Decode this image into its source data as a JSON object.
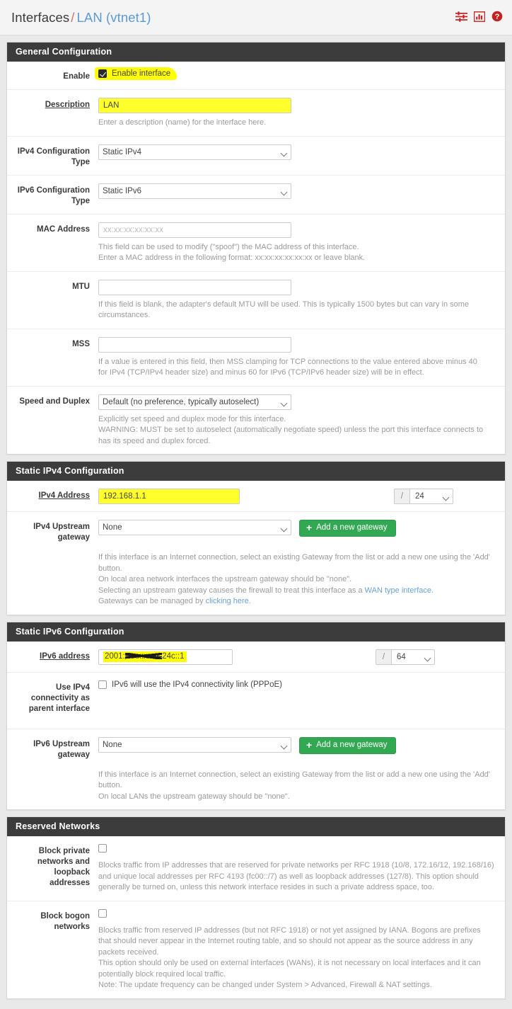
{
  "header": {
    "breadcrumb_root": "Interfaces",
    "breadcrumb_separator": "/",
    "breadcrumb_current": "LAN (vtnet1)",
    "icons": [
      "sliders-icon",
      "chart-bar-icon",
      "help-circle-icon"
    ],
    "accent_red": "#c32222",
    "link_blue": "#5b9bd5"
  },
  "sections": {
    "general": {
      "title": "General Configuration",
      "enable": {
        "label": "Enable",
        "checkbox_label": "Enable interface",
        "checked": true,
        "highlighted": true
      },
      "description": {
        "label": "Description",
        "value": "LAN",
        "help": "Enter a description (name) for the interface here.",
        "highlighted": true
      },
      "ipv4_config_type": {
        "label": "IPv4 Configuration Type",
        "value": "Static IPv4",
        "highlighted": true
      },
      "ipv6_config_type": {
        "label": "IPv6 Configuration Type",
        "value": "Static IPv6",
        "highlighted": true
      },
      "mac_address": {
        "label": "MAC Address",
        "value": "",
        "placeholder": "xx:xx:xx:xx:xx:xx",
        "help_line1": "This field can be used to modify (\"spoof\") the MAC address of this interface.",
        "help_line2": "Enter a MAC address in the following format: xx:xx:xx:xx:xx:xx or leave blank."
      },
      "mtu": {
        "label": "MTU",
        "value": "",
        "help": "If this field is blank, the adapter's default MTU will be used. This is typically 1500 bytes but can vary in some circumstances."
      },
      "mss": {
        "label": "MSS",
        "value": "",
        "help": "If a value is entered in this field, then MSS clamping for TCP connections to the value entered above minus 40 for IPv4 (TCP/IPv4 header size) and minus 60 for IPv6 (TCP/IPv6 header size) will be in effect."
      },
      "speed_duplex": {
        "label": "Speed and Duplex",
        "value": "Default (no preference, typically autoselect)",
        "help_line1": "Explicitly set speed and duplex mode for this interface.",
        "help_line2": "WARNING: MUST be set to autoselect (automatically negotiate speed) unless the port this interface connects to has its speed and duplex forced."
      }
    },
    "static_ipv4": {
      "title": "Static IPv4 Configuration",
      "address": {
        "label": "IPv4 Address",
        "value": "192.168.1.1",
        "highlighted": true,
        "slash": "/",
        "prefix": "24"
      },
      "upstream_gateway": {
        "label": "IPv4 Upstream gateway",
        "value": "None",
        "button_label": "Add a new gateway",
        "button_icon": "plus-icon",
        "help_line1": "If this interface is an Internet connection, select an existing Gateway from the list or add a new one using the 'Add' button.",
        "help_line2": "On local area network interfaces the upstream gateway should be \"none\".",
        "help_line3_pre": "Selecting an upstream gateway causes the firewall to treat this interface as a ",
        "help_line3_link": "WAN type interface",
        "help_line3_post": ".",
        "help_line4_pre": "Gateways can be managed by ",
        "help_line4_link": "clicking here",
        "help_line4_post": "."
      }
    },
    "static_ipv6": {
      "title": "Static IPv6 Configuration",
      "address": {
        "label": "IPv6 address",
        "value_prefix": "2001:",
        "value_redacted": "xxxx:xxxx:",
        "value_suffix": "24c::1",
        "highlighted": true,
        "slash": "/",
        "prefix": "64"
      },
      "use_ipv4_connectivity": {
        "label": "Use IPv4 connectivity as parent interface",
        "checkbox_label": "IPv6 will use the IPv4 connectivity link (PPPoE)",
        "checked": false
      },
      "upstream_gateway": {
        "label": "IPv6 Upstream gateway",
        "value": "None",
        "button_label": "Add a new gateway",
        "button_icon": "plus-icon",
        "help_line1": "If this interface is an Internet connection, select an existing Gateway from the list or add a new one using the 'Add' button.",
        "help_line2": "On local LANs the upstream gateway should be \"none\"."
      }
    },
    "reserved_networks": {
      "title": "Reserved Networks",
      "block_private": {
        "label": "Block private networks and loopback addresses",
        "checked": false,
        "help": "Blocks traffic from IP addresses that are reserved for private networks per RFC 1918 (10/8, 172.16/12, 192.168/16) and unique local addresses per RFC 4193 (fc00::/7) as well as loopback addresses (127/8). This option should generally be turned on, unless this network interface resides in such a private address space, too."
      },
      "block_bogon": {
        "label": "Block bogon networks",
        "checked": false,
        "help_line1": "Blocks traffic from reserved IP addresses (but not RFC 1918) or not yet assigned by IANA. Bogons are prefixes that should never appear in the Internet routing table, and so should not appear as the source address in any packets received.",
        "help_line2": "This option should only be used on external interfaces (WANs), it is not necessary on local interfaces and it can potentially block required local traffic.",
        "help_line3": "Note: The update frequency can be changed under System > Advanced, Firewall & NAT settings."
      }
    }
  }
}
